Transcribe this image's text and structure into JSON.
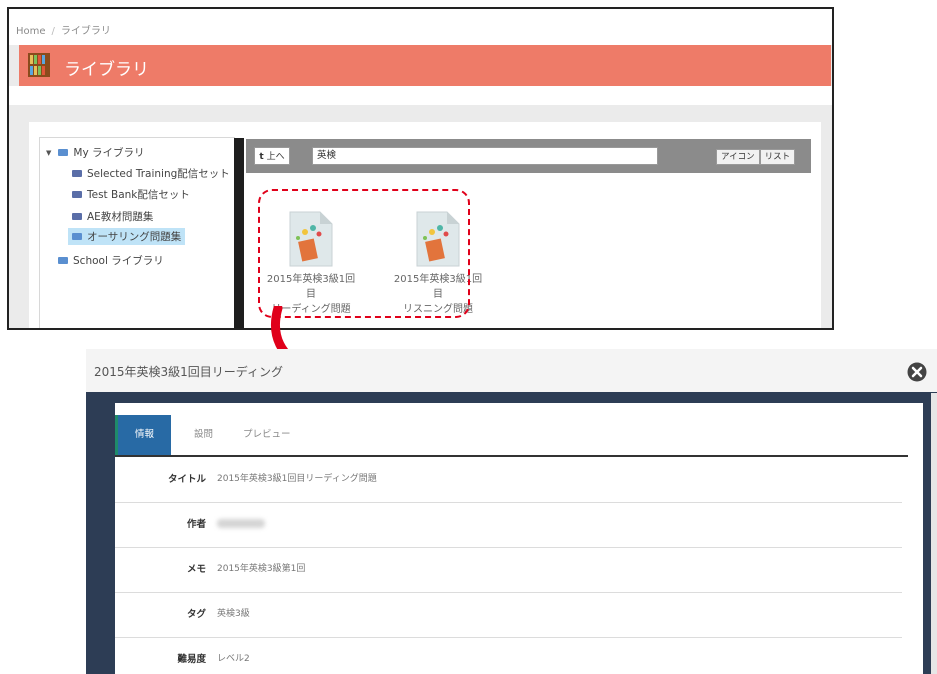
{
  "library": {
    "breadcrumb": {
      "home": "Home",
      "separator": "/",
      "current": "ライブラリ"
    },
    "header_title": "ライブラリ",
    "tree": {
      "root": "My ライブラリ",
      "items": [
        "Selected Training配信セット",
        "Test Bank配信セット",
        "AE教材問題集",
        "オーサリング問題集"
      ],
      "school": "School ライブラリ"
    },
    "toolbar": {
      "up_label": "上へ",
      "search_value": "英検",
      "view_icon": "アイコン",
      "view_list": "リスト"
    },
    "files": [
      {
        "line1": "2015年英検3級1回目",
        "line2": "リーディング問題"
      },
      {
        "line1": "2015年英検3級1回目",
        "line2": "リスニング問題"
      }
    ]
  },
  "modal": {
    "title": "2015年英検3級1回目リーディング",
    "tabs": [
      "情報",
      "設問",
      "プレビュー"
    ],
    "fields": [
      {
        "label": "タイトル",
        "value": "2015年英検3級1回目リーディング問題"
      },
      {
        "label": "作者",
        "value": ""
      },
      {
        "label": "メモ",
        "value": "2015年英検3級第1回"
      },
      {
        "label": "タグ",
        "value": "英検3級"
      },
      {
        "label": "難易度",
        "value": "レベル2"
      }
    ]
  },
  "colors": {
    "header_bg": "#ee7b68",
    "tab_active": "#286aa5",
    "highlight": "#e0001a",
    "modal_frame": "#2d3d55"
  }
}
